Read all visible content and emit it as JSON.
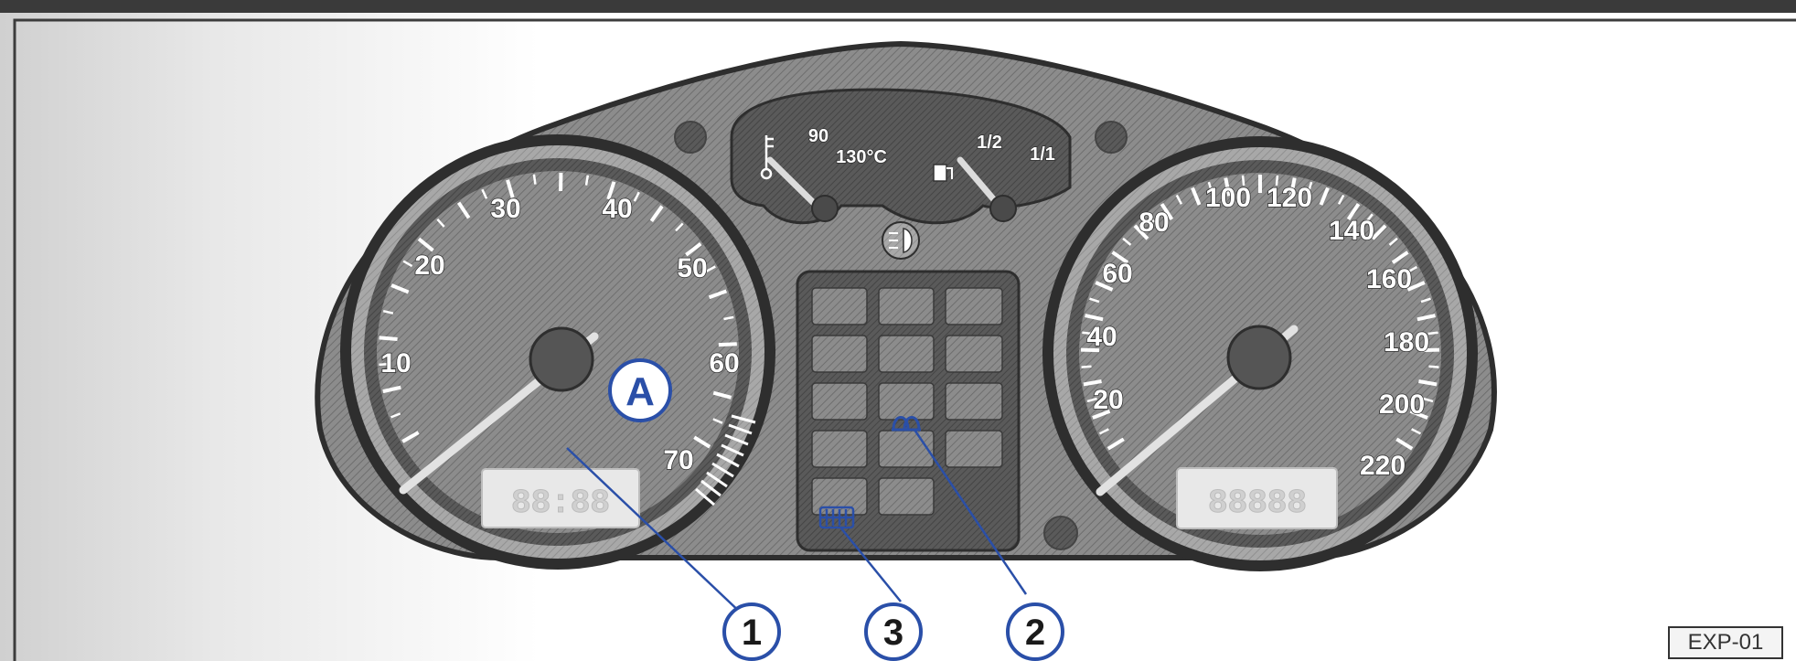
{
  "figure": {
    "code": "EXP-01",
    "callouts": {
      "a": "A",
      "one": "1",
      "two": "2",
      "three": "3"
    }
  },
  "tachometer": {
    "scale": [
      "10",
      "20",
      "30",
      "40",
      "50",
      "60",
      "70"
    ],
    "odometer_display": "88:88"
  },
  "speedometer": {
    "scale": [
      "20",
      "40",
      "60",
      "80",
      "100",
      "120",
      "140",
      "160",
      "180",
      "200",
      "220"
    ],
    "odometer_display": "88888"
  },
  "temperature_gauge": {
    "labels": [
      "90",
      "130°C"
    ]
  },
  "fuel_gauge": {
    "labels": [
      "1/2",
      "1/1"
    ]
  }
}
